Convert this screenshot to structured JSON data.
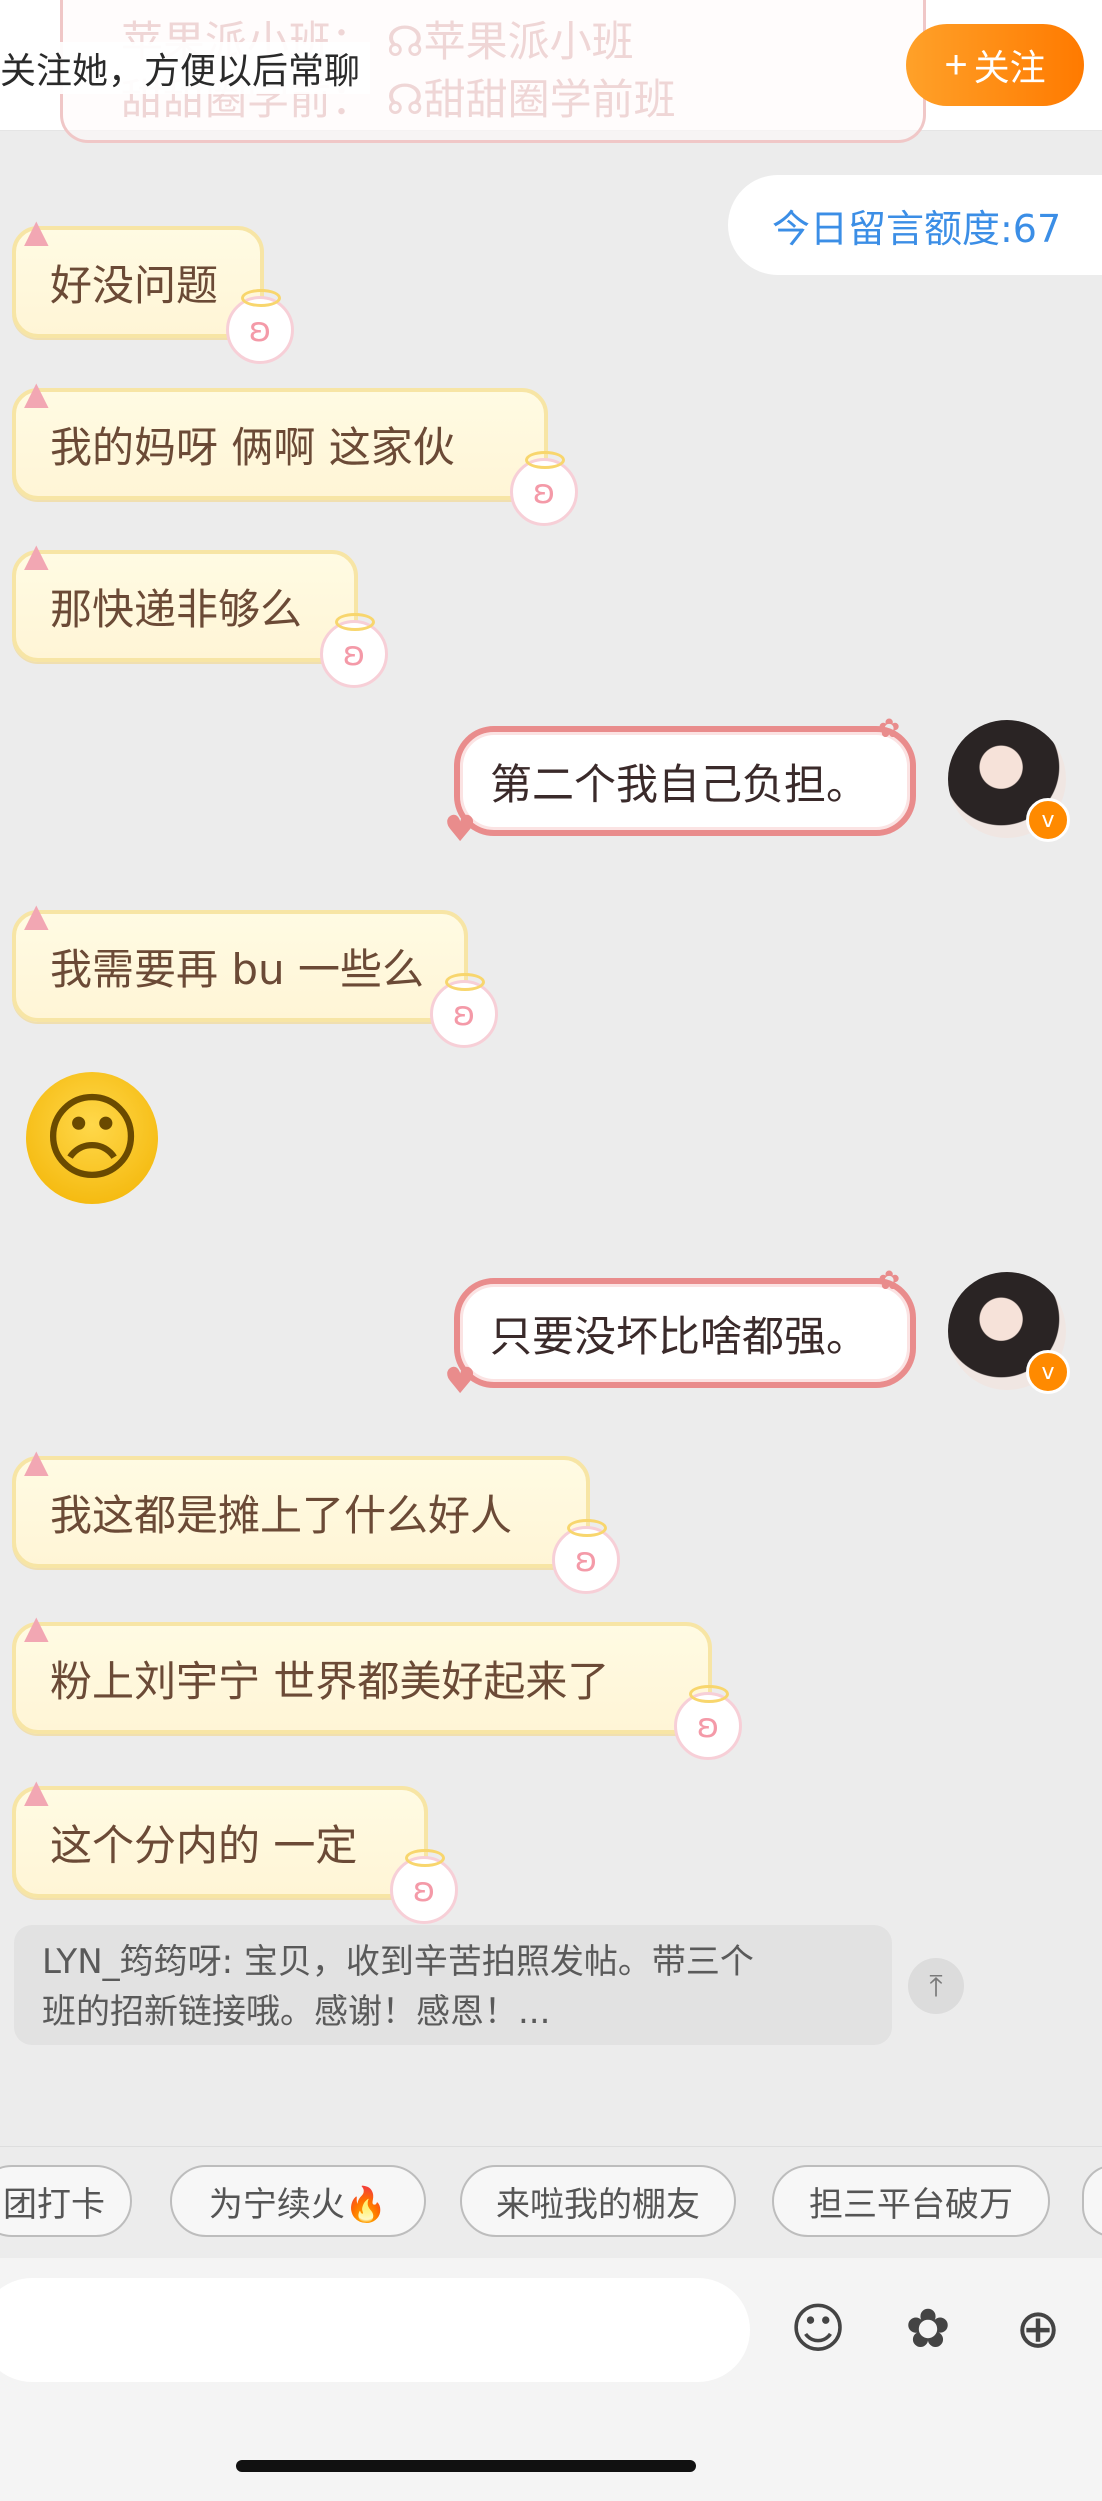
{
  "header": {
    "hint_text": "关注她，方便以后常聊",
    "ghost_line1": "苹果派小班：  ☊苹果派小班",
    "ghost_line2": "甜甜圈学前：  ☊甜甜圈学前班",
    "follow_label": "关注",
    "follow_icon": "plus-icon",
    "accent": "#ff8a00"
  },
  "quota_text": "今日留言额度:67",
  "messages": [
    {
      "side": "in",
      "text": "好没问题"
    },
    {
      "side": "in",
      "text": "我的妈呀  俩啊  这家伙"
    },
    {
      "side": "in",
      "text": "那快递非够么"
    },
    {
      "side": "out",
      "text": "第二个我自己负担。"
    },
    {
      "side": "in",
      "text": "我需要再 bu 一些么"
    },
    {
      "side": "in",
      "emoji": "crying-face"
    },
    {
      "side": "out",
      "text": "只要没坏比啥都强。"
    },
    {
      "side": "in",
      "text": "我这都是摊上了什么好人"
    },
    {
      "side": "in",
      "text": "粉上刘宇宁  世界都美好起来了"
    },
    {
      "side": "in",
      "text": "这个分内的  一定"
    }
  ],
  "quote": {
    "line1": "LYN_筠筠呀: 宝贝，收到辛苦拍照发帖。带三个",
    "line2": "班的招新链接哦。感谢！感恩！..."
  },
  "chips": [
    "团打卡",
    "为宁续火🔥",
    "来啦我的棚友",
    "担三平台破万"
  ],
  "toolbar": {
    "emoji_icon": "smiley-icon",
    "sticker_icon": "flower-sticker-icon",
    "more_icon": "plus-circle-icon"
  }
}
